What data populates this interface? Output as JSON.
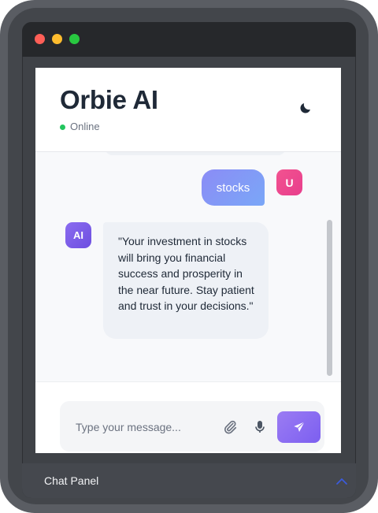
{
  "app": {
    "title": "Orbie AI",
    "status": "Online",
    "status_color": "#22c55e"
  },
  "icons": {
    "theme_toggle": "moon-icon",
    "attach": "paperclip-icon",
    "mic": "microphone-icon",
    "send": "send-icon",
    "panel_toggle": "chevron-up-icon"
  },
  "messages": [
    {
      "sender": "user",
      "avatar": "U",
      "text": "stocks"
    },
    {
      "sender": "ai",
      "avatar": "AI",
      "text": "\"Your investment in stocks will bring you financial success and prosperity in the near future. Stay patient and trust in your decisions.\""
    }
  ],
  "composer": {
    "placeholder": "Type your message..."
  },
  "panel": {
    "label": "Chat Panel"
  },
  "colors": {
    "accent": "#7c5ff0",
    "user_bubble": "#8b8cf6",
    "user_avatar": "#e83e8c",
    "ai_avatar": "#6d4fe0"
  }
}
